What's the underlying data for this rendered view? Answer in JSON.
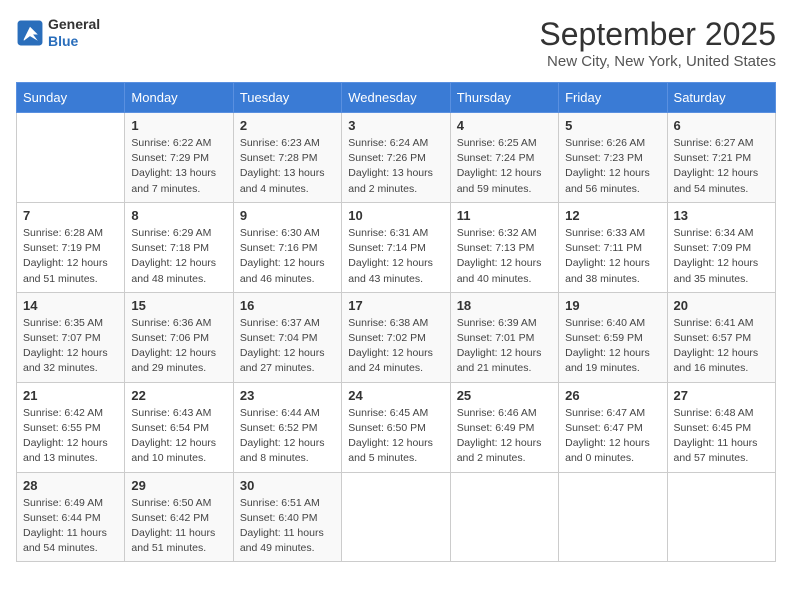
{
  "header": {
    "logo_line1": "General",
    "logo_line2": "Blue",
    "month": "September 2025",
    "location": "New City, New York, United States"
  },
  "weekdays": [
    "Sunday",
    "Monday",
    "Tuesday",
    "Wednesday",
    "Thursday",
    "Friday",
    "Saturday"
  ],
  "weeks": [
    [
      {
        "day": "",
        "info": ""
      },
      {
        "day": "1",
        "info": "Sunrise: 6:22 AM\nSunset: 7:29 PM\nDaylight: 13 hours\nand 7 minutes."
      },
      {
        "day": "2",
        "info": "Sunrise: 6:23 AM\nSunset: 7:28 PM\nDaylight: 13 hours\nand 4 minutes."
      },
      {
        "day": "3",
        "info": "Sunrise: 6:24 AM\nSunset: 7:26 PM\nDaylight: 13 hours\nand 2 minutes."
      },
      {
        "day": "4",
        "info": "Sunrise: 6:25 AM\nSunset: 7:24 PM\nDaylight: 12 hours\nand 59 minutes."
      },
      {
        "day": "5",
        "info": "Sunrise: 6:26 AM\nSunset: 7:23 PM\nDaylight: 12 hours\nand 56 minutes."
      },
      {
        "day": "6",
        "info": "Sunrise: 6:27 AM\nSunset: 7:21 PM\nDaylight: 12 hours\nand 54 minutes."
      }
    ],
    [
      {
        "day": "7",
        "info": "Sunrise: 6:28 AM\nSunset: 7:19 PM\nDaylight: 12 hours\nand 51 minutes."
      },
      {
        "day": "8",
        "info": "Sunrise: 6:29 AM\nSunset: 7:18 PM\nDaylight: 12 hours\nand 48 minutes."
      },
      {
        "day": "9",
        "info": "Sunrise: 6:30 AM\nSunset: 7:16 PM\nDaylight: 12 hours\nand 46 minutes."
      },
      {
        "day": "10",
        "info": "Sunrise: 6:31 AM\nSunset: 7:14 PM\nDaylight: 12 hours\nand 43 minutes."
      },
      {
        "day": "11",
        "info": "Sunrise: 6:32 AM\nSunset: 7:13 PM\nDaylight: 12 hours\nand 40 minutes."
      },
      {
        "day": "12",
        "info": "Sunrise: 6:33 AM\nSunset: 7:11 PM\nDaylight: 12 hours\nand 38 minutes."
      },
      {
        "day": "13",
        "info": "Sunrise: 6:34 AM\nSunset: 7:09 PM\nDaylight: 12 hours\nand 35 minutes."
      }
    ],
    [
      {
        "day": "14",
        "info": "Sunrise: 6:35 AM\nSunset: 7:07 PM\nDaylight: 12 hours\nand 32 minutes."
      },
      {
        "day": "15",
        "info": "Sunrise: 6:36 AM\nSunset: 7:06 PM\nDaylight: 12 hours\nand 29 minutes."
      },
      {
        "day": "16",
        "info": "Sunrise: 6:37 AM\nSunset: 7:04 PM\nDaylight: 12 hours\nand 27 minutes."
      },
      {
        "day": "17",
        "info": "Sunrise: 6:38 AM\nSunset: 7:02 PM\nDaylight: 12 hours\nand 24 minutes."
      },
      {
        "day": "18",
        "info": "Sunrise: 6:39 AM\nSunset: 7:01 PM\nDaylight: 12 hours\nand 21 minutes."
      },
      {
        "day": "19",
        "info": "Sunrise: 6:40 AM\nSunset: 6:59 PM\nDaylight: 12 hours\nand 19 minutes."
      },
      {
        "day": "20",
        "info": "Sunrise: 6:41 AM\nSunset: 6:57 PM\nDaylight: 12 hours\nand 16 minutes."
      }
    ],
    [
      {
        "day": "21",
        "info": "Sunrise: 6:42 AM\nSunset: 6:55 PM\nDaylight: 12 hours\nand 13 minutes."
      },
      {
        "day": "22",
        "info": "Sunrise: 6:43 AM\nSunset: 6:54 PM\nDaylight: 12 hours\nand 10 minutes."
      },
      {
        "day": "23",
        "info": "Sunrise: 6:44 AM\nSunset: 6:52 PM\nDaylight: 12 hours\nand 8 minutes."
      },
      {
        "day": "24",
        "info": "Sunrise: 6:45 AM\nSunset: 6:50 PM\nDaylight: 12 hours\nand 5 minutes."
      },
      {
        "day": "25",
        "info": "Sunrise: 6:46 AM\nSunset: 6:49 PM\nDaylight: 12 hours\nand 2 minutes."
      },
      {
        "day": "26",
        "info": "Sunrise: 6:47 AM\nSunset: 6:47 PM\nDaylight: 12 hours\nand 0 minutes."
      },
      {
        "day": "27",
        "info": "Sunrise: 6:48 AM\nSunset: 6:45 PM\nDaylight: 11 hours\nand 57 minutes."
      }
    ],
    [
      {
        "day": "28",
        "info": "Sunrise: 6:49 AM\nSunset: 6:44 PM\nDaylight: 11 hours\nand 54 minutes."
      },
      {
        "day": "29",
        "info": "Sunrise: 6:50 AM\nSunset: 6:42 PM\nDaylight: 11 hours\nand 51 minutes."
      },
      {
        "day": "30",
        "info": "Sunrise: 6:51 AM\nSunset: 6:40 PM\nDaylight: 11 hours\nand 49 minutes."
      },
      {
        "day": "",
        "info": ""
      },
      {
        "day": "",
        "info": ""
      },
      {
        "day": "",
        "info": ""
      },
      {
        "day": "",
        "info": ""
      }
    ]
  ]
}
